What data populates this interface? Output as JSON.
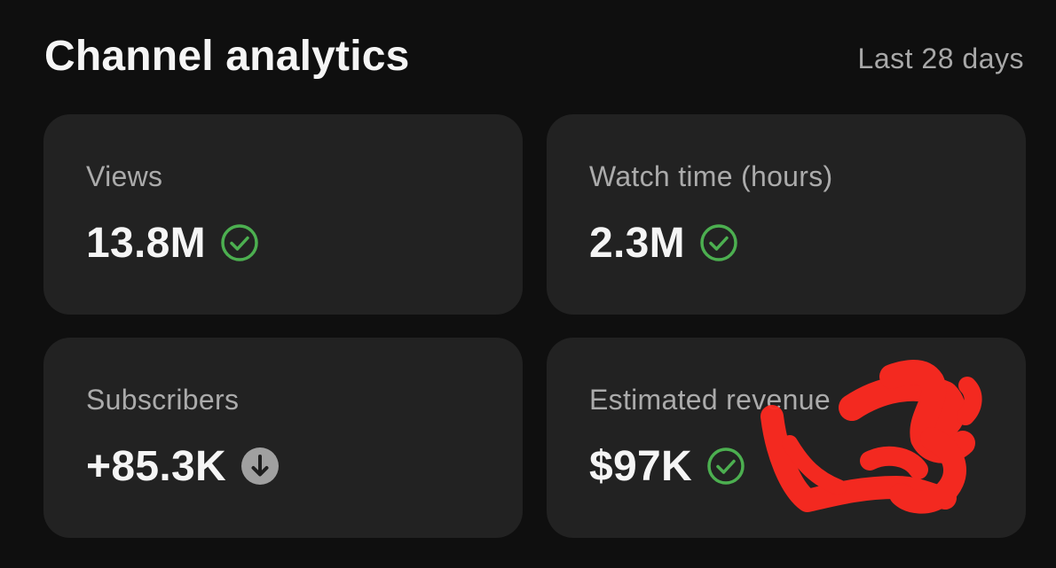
{
  "header": {
    "title": "Channel analytics",
    "period": "Last 28 days"
  },
  "cards": [
    {
      "label": "Views",
      "value": "13.8M",
      "status_icon": "check-circle-icon",
      "status_color": "#4caf50"
    },
    {
      "label": "Watch time (hours)",
      "value": "2.3M",
      "status_icon": "check-circle-icon",
      "status_color": "#4caf50"
    },
    {
      "label": "Subscribers",
      "value": "+85.3K",
      "status_icon": "down-arrow-circle-icon",
      "status_color": "#a0a0a0"
    },
    {
      "label": "Estimated revenue",
      "value": "$97K",
      "status_icon": "check-circle-icon",
      "status_color": "#4caf50"
    }
  ],
  "colors": {
    "background": "#0f0f0f",
    "card": "#222222",
    "scribble": "#ff2a20"
  }
}
